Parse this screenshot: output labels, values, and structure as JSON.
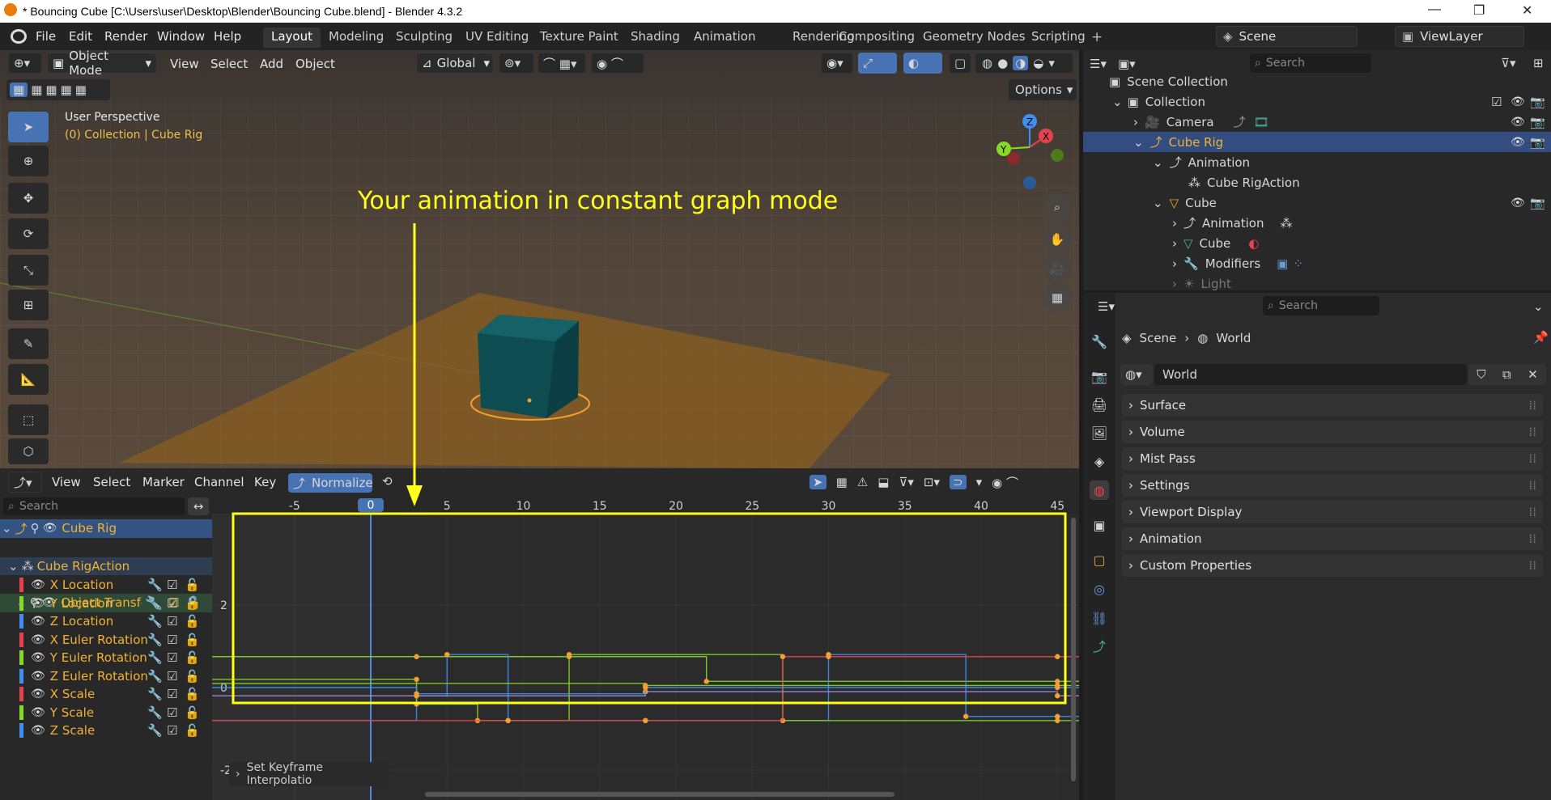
{
  "window": {
    "title": "* Bouncing Cube [C:\\Users\\user\\Desktop\\Blender\\Bouncing Cube.blend] - Blender 4.3.2",
    "minimize": "—",
    "maximize": "❐",
    "close": "✕"
  },
  "menu": {
    "file": "File",
    "edit": "Edit",
    "render": "Render",
    "window": "Window",
    "help": "Help"
  },
  "workspaces": [
    "Layout",
    "Modeling",
    "Sculpting",
    "UV Editing",
    "Texture Paint",
    "Shading",
    "Animation",
    "Rendering",
    "Compositing",
    "Geometry Nodes",
    "Scripting"
  ],
  "add_workspace": "+",
  "scene": {
    "name": "Scene",
    "view_layer": "ViewLayer"
  },
  "viewport": {
    "mode": "Object Mode",
    "menus": {
      "view": "View",
      "select": "Select",
      "add": "Add",
      "object": "Object"
    },
    "transform_orientation": "Global",
    "options": "Options",
    "perspective_label": "User Perspective",
    "collection_label": "(0) Collection | Cube Rig",
    "gizmo": {
      "z": "Z",
      "y": "Y",
      "x": "X"
    },
    "annotation": "Your animation in constant graph mode"
  },
  "graph": {
    "menus": {
      "view": "View",
      "select": "Select",
      "marker": "Marker",
      "channel": "Channel",
      "key": "Key"
    },
    "normalize": "Normalize",
    "search_placeholder": "Search",
    "current_frame": "0",
    "frame_ticks": [
      "-5",
      "5",
      "10",
      "15",
      "20",
      "25",
      "30",
      "35",
      "40",
      "45"
    ],
    "value_ticks": [
      "2",
      "0",
      "-2"
    ],
    "operator_panel": "Set Keyframe Interpolatio",
    "channels": {
      "object": "Cube Rig",
      "action": "Cube RigAction",
      "group": "Object Transfor",
      "fcurves": [
        {
          "name": "X Location",
          "color": "#e8414e"
        },
        {
          "name": "Y Location",
          "color": "#86d926"
        },
        {
          "name": "Z Location",
          "color": "#3d8ff2"
        },
        {
          "name": "X Euler Rotation",
          "color": "#e8414e"
        },
        {
          "name": "Y Euler Rotation",
          "color": "#86d926"
        },
        {
          "name": "Z Euler Rotation",
          "color": "#3d8ff2"
        },
        {
          "name": "X Scale",
          "color": "#e8414e"
        },
        {
          "name": "Y Scale",
          "color": "#86d926"
        },
        {
          "name": "Z Scale",
          "color": "#3d8ff2"
        }
      ]
    }
  },
  "outliner": {
    "search_placeholder": "Search",
    "items": {
      "scene_collection": "Scene Collection",
      "collection": "Collection",
      "camera": "Camera",
      "cube_rig": "Cube Rig",
      "animation1": "Animation",
      "action": "Cube RigAction",
      "cube": "Cube",
      "animation2": "Animation",
      "cube_mesh": "Cube",
      "modifiers": "Modifiers",
      "light": "Light"
    }
  },
  "properties": {
    "search_placeholder": "Search",
    "breadcrumb": {
      "scene": "Scene",
      "world": "World"
    },
    "world_name": "World",
    "panels": [
      "Surface",
      "Volume",
      "Mist Pass",
      "Settings",
      "Viewport Display",
      "Animation",
      "Custom Properties"
    ]
  },
  "colors": {
    "accent": "#4772b3",
    "highlight": "#f0a030",
    "annotation": "#ffff1a",
    "selected_row": "#334d80"
  }
}
